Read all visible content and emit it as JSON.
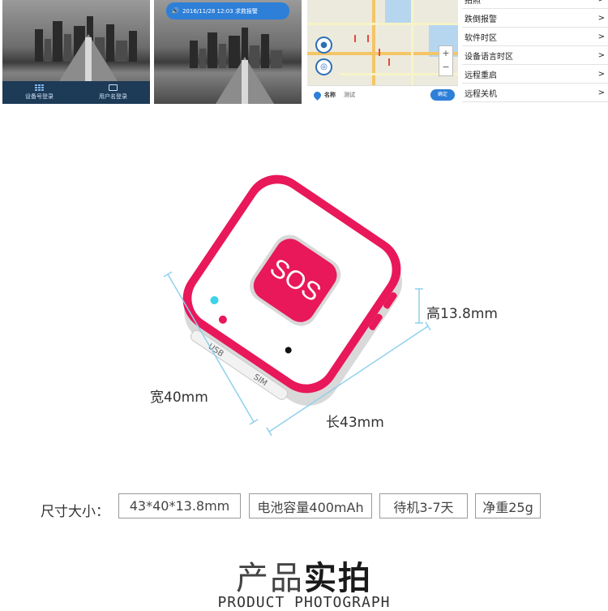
{
  "screens": {
    "login": {
      "tabs": [
        {
          "label": "设备号登录",
          "icon": "grid-icon"
        },
        {
          "label": "用户名登录",
          "icon": "id-card-icon"
        }
      ]
    },
    "notification": {
      "text": "2016/11/28 12:03 求救报警",
      "icon": "speaker-icon"
    },
    "map": {
      "field_label": "名称",
      "field_value": "测试",
      "confirm_label": "确定",
      "zoom_in": "+",
      "zoom_out": "−"
    },
    "settings": {
      "items": [
        {
          "label": "拍照",
          "arrow": ">"
        },
        {
          "label": "跌倒报警",
          "arrow": ">"
        },
        {
          "label": "软件时区",
          "arrow": ">"
        },
        {
          "label": "设备语言时区",
          "arrow": ">"
        },
        {
          "label": "远程重启",
          "arrow": ">"
        },
        {
          "label": "远程关机",
          "arrow": ">"
        }
      ]
    }
  },
  "device": {
    "button_label": "SOS",
    "port_label_usb": "USB",
    "port_label_sim": "SIM",
    "colors": {
      "accent": "#e8185a",
      "body": "#ffffff",
      "dimension_line": "#8fd0ee"
    }
  },
  "dimensions": {
    "height": "高13.8mm",
    "width": "宽40mm",
    "length": "长43mm"
  },
  "specs": {
    "label": "尺寸大小：",
    "tags": [
      "43*40*13.8mm",
      "电池容量400mAh",
      "待机3-7天",
      "净重25g"
    ]
  },
  "section": {
    "title_light": "产品",
    "title_bold": "实拍",
    "subtitle": "PRODUCT PHOTOGRAPH"
  }
}
